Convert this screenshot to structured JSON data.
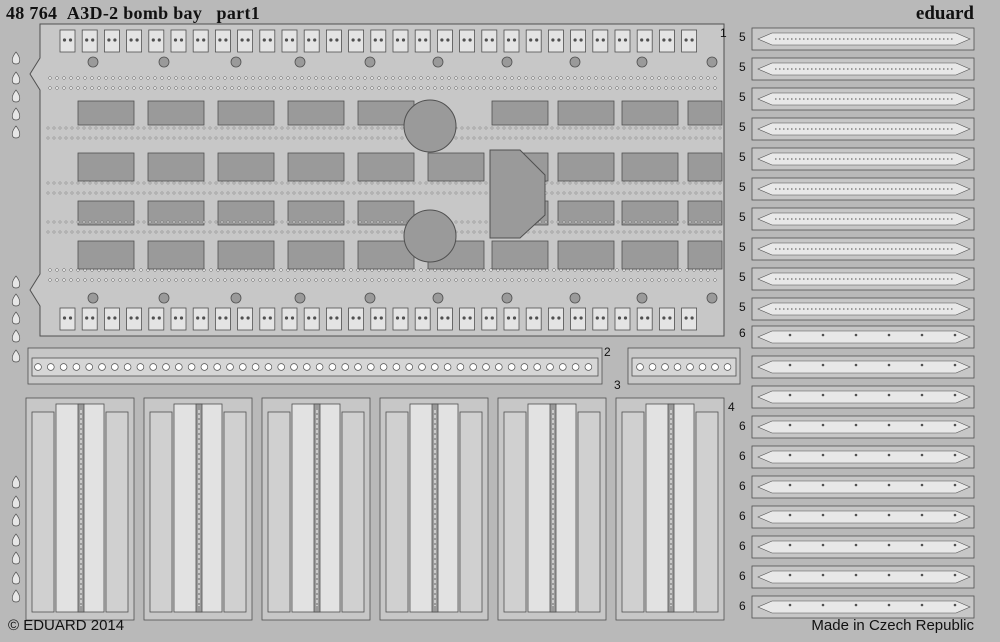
{
  "header": {
    "code": "48 764",
    "title": "A3D-2 bomb bay",
    "part": "part1",
    "brand": "eduard"
  },
  "footer": {
    "copyright": "© EDUARD 2014",
    "origin": "Made in Czech Republic"
  },
  "part_numbers": {
    "p1": "1",
    "p2": "2",
    "p3": "3",
    "p4": "4",
    "p5": "5",
    "p6": "6"
  },
  "colors": {
    "background": "#b9b9b9",
    "metal": "#c7c7c7",
    "etched": "#9a9a9a",
    "outline": "#505050",
    "text": "#111111"
  }
}
